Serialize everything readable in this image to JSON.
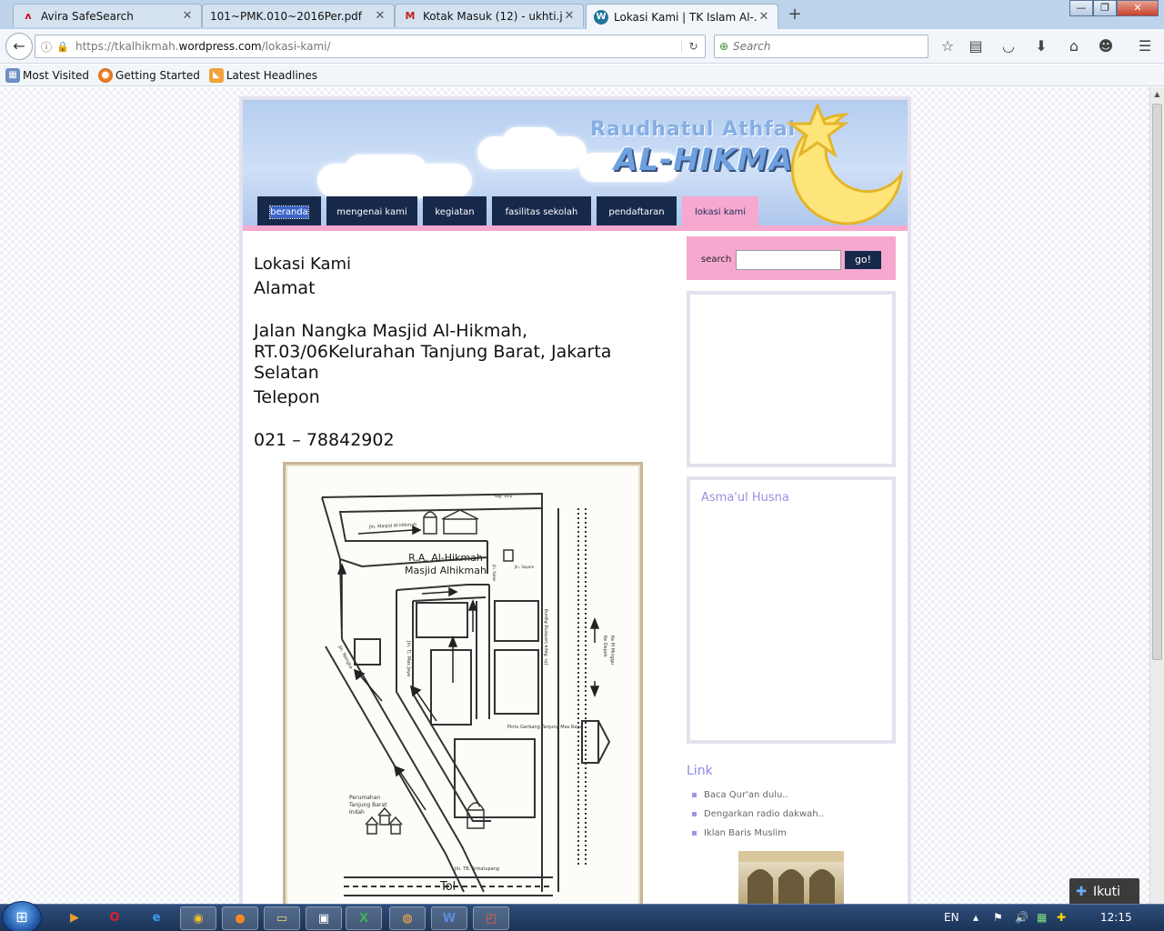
{
  "browser": {
    "tabs": [
      {
        "title": "Avira SafeSearch",
        "icon": "avira-icon"
      },
      {
        "title": "101~PMK.010~2016Per.pdf",
        "icon": "pdf-icon"
      },
      {
        "title": "Kotak Masuk (12) - ukhti.ju...",
        "icon": "gmail-icon"
      },
      {
        "title": "Lokasi Kami | TK Islam Al-...",
        "icon": "wordpress-icon",
        "active": true
      }
    ],
    "url_prefix": "https://tkalhikmah.",
    "url_domain": "wordpress.com",
    "url_path": "/lokasi-kami/",
    "search_placeholder": "Search",
    "bookmarks": [
      "Most Visited",
      "Getting Started",
      "Latest Headlines"
    ]
  },
  "site": {
    "title_line1": "Raudhatul Athfal",
    "title_line2": "AL-HIKMAH",
    "nav": [
      {
        "label": "beranda"
      },
      {
        "label": "mengenai kami"
      },
      {
        "label": "kegiatan"
      },
      {
        "label": "fasilitas sekolah"
      },
      {
        "label": "pendaftaran"
      },
      {
        "label": "lokasi kami",
        "active": true
      }
    ]
  },
  "content": {
    "page_title": "Lokasi Kami",
    "address_heading": "Alamat",
    "address_line1": "Jalan Nangka Masjid Al-Hikmah,",
    "address_line2": "RT.03/06Kelurahan Tanjung Barat, Jakarta",
    "address_line3": "Selatan",
    "phone_heading": "Telepon",
    "phone_number": "021 – 78842902"
  },
  "map": {
    "title_line1": "R.A. Al-Hikmah",
    "title_line2": "Masjid Alhikmah",
    "road_top": "Gg. 102",
    "road_mosque": "Jln. Masjid Al-Hikmah",
    "road_sapam": "Jln. Sapam",
    "road_kober": "Jln. Kober",
    "road_nangka": "Jln. Nangka",
    "road_tj_mas_jaya": "Jln. Tj. Mas Jaya",
    "road_raya_lenteng": "Jln. Raya Lenteng Agung",
    "road_tol_simatupang": "Jln. TB. Simatupang",
    "toll": "Tol",
    "gate": "Pintu Gerbang Tanjung Mas Raya",
    "housing_line1": "Perumahan",
    "housing_line2": "Tanjung Barat",
    "housing_line3": "Indah",
    "direction": "Ke Depok",
    "direction2": "Ke Pl Minggu"
  },
  "sidebar": {
    "search_label": "search",
    "search_button": "go!",
    "widget_title": "Asma'ul Husna",
    "links_title": "Link",
    "links": [
      "Baca Qur'an dulu..",
      "Dengarkan radio dakwah..",
      "Iklan Baris Muslim"
    ]
  },
  "follow_button": "Ikuti",
  "taskbar": {
    "lang": "EN",
    "time": "12:15"
  },
  "colors": {
    "nav_bg": "#17294b",
    "nav_active": "#f7a8cf",
    "link_title": "#8c8ae6"
  }
}
